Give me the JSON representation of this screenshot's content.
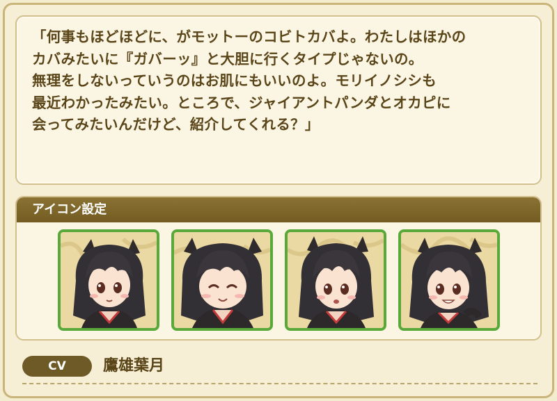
{
  "profile": {
    "quote": "「何事もほどほどに、がモットーのコビトカバよ。わたしはほかの\nカバみたいに『ガバーッ』と大胆に行くタイプじゃないの。\n無理をしないっていうのはお肌にもいいのよ。モリイノシシも\n最近わかったみたい。ところで、ジャイアントパンダとオカピに\n会ってみたいんだけど、紹介してくれる？」"
  },
  "icon_settings": {
    "title": "アイコン設定",
    "icons": [
      {
        "expression": "neutral"
      },
      {
        "expression": "smiling-eyes-closed"
      },
      {
        "expression": "surprised"
      },
      {
        "expression": "grinning"
      }
    ]
  },
  "voice": {
    "label": "CV",
    "actor": "鷹雄葉月"
  },
  "colors": {
    "frame": "#c9b47a",
    "header": "#735c22",
    "text": "#5a4519",
    "icon_border": "#58a83a"
  }
}
